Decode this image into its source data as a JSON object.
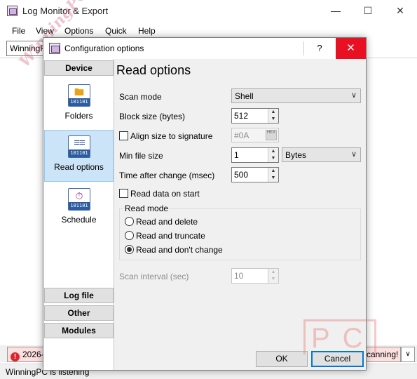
{
  "main": {
    "title": "Log Monitor & Export",
    "menu": [
      "File",
      "View",
      "Options",
      "Quick",
      "Help"
    ],
    "source_value": "WinningPC",
    "log_message_left": "2026-",
    "log_message_right": "scanning!",
    "status_text": "WinningPC is listening",
    "watermark": "WinningPC",
    "watermark_pc": "PC"
  },
  "dialog": {
    "title": "Configuration options",
    "help_label": "?",
    "close_label": "✕",
    "categories": {
      "device": "Device",
      "log_file": "Log file",
      "other": "Other",
      "modules": "Modules"
    },
    "nav_items": [
      {
        "label": "Folders",
        "icon": "folder-icon"
      },
      {
        "label": "Read options",
        "icon": "sliders-icon",
        "selected": true
      },
      {
        "label": "Schedule",
        "icon": "timer-icon"
      }
    ],
    "nav_icon_bits": "101101",
    "heading": "Read options",
    "scan_mode": {
      "label": "Scan mode",
      "value": "Shell"
    },
    "block_size": {
      "label": "Block size (bytes)",
      "value": "512"
    },
    "align": {
      "label": "Align size to signature",
      "checked": false,
      "value": "#0A",
      "hex_icon_text": "HEX"
    },
    "min_file_size": {
      "label": "Min file size",
      "value": "1",
      "unit": "Bytes"
    },
    "time_after_change": {
      "label": "Time after change (msec)",
      "value": "500"
    },
    "read_on_start": {
      "label": "Read data on start",
      "checked": false
    },
    "read_mode": {
      "title": "Read mode",
      "options": [
        "Read and delete",
        "Read and truncate",
        "Read and don't change"
      ],
      "selected_index": 2
    },
    "scan_interval": {
      "label": "Scan interval (sec)",
      "value": "10",
      "disabled": true
    },
    "buttons": {
      "ok": "OK",
      "cancel": "Cancel"
    }
  },
  "colors": {
    "accent": "#0078d7",
    "close_red": "#e81123",
    "selection": "#cce4f7",
    "icon_blue": "#2d5c9e"
  }
}
